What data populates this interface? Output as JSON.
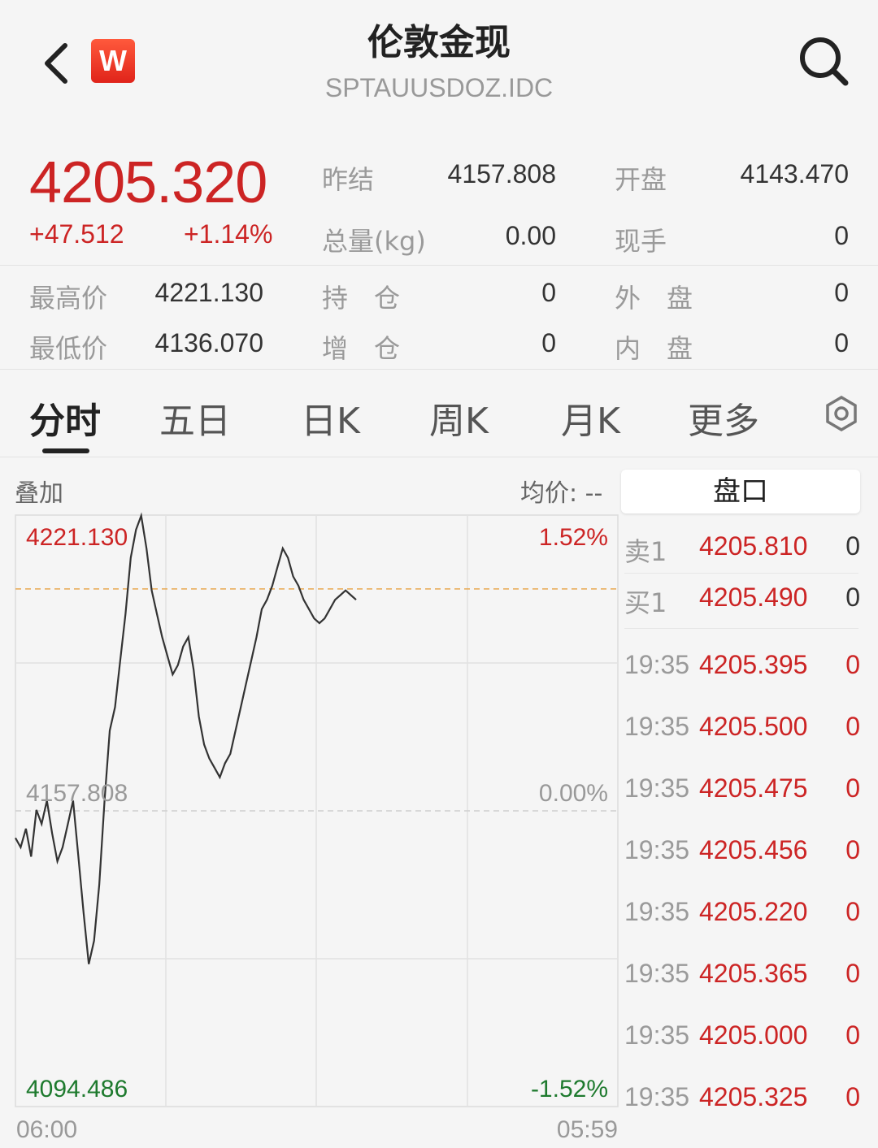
{
  "header": {
    "title": "伦敦金现",
    "subtitle": "SPTAUUSDOZ.IDC",
    "logo_letter": "W"
  },
  "quote": {
    "price": "4205.320",
    "change": "+47.512",
    "change_pct": "+1.14%",
    "stats": [
      {
        "label": "昨结",
        "value": "4157.808"
      },
      {
        "label": "开盘",
        "value": "4143.470"
      },
      {
        "label": "总量(kg)",
        "value": "0.00"
      },
      {
        "label": "现手",
        "value": "0"
      },
      {
        "label": "最高价",
        "value": "4221.130"
      },
      {
        "label": "持　仓",
        "value": "0"
      },
      {
        "label": "外　盘",
        "value": "0"
      },
      {
        "label": "最低价",
        "value": "4136.070"
      },
      {
        "label": "增　仓",
        "value": "0"
      },
      {
        "label": "内　盘",
        "value": "0"
      }
    ]
  },
  "tabs": [
    "分时",
    "五日",
    "日K",
    "周K",
    "月K",
    "更多"
  ],
  "active_tab": "分时",
  "chart_toolbar": {
    "overlay": "叠加",
    "avg_price": "均价: --"
  },
  "chart_data": {
    "type": "line",
    "price_high": 4221.13,
    "price_ref": 4157.808,
    "price_low": 4094.486,
    "high_label": "4221.130",
    "ref_label": "4157.808",
    "low_label": "4094.486",
    "pct_high": "1.52%",
    "pct_ref": "0.00%",
    "pct_low": "-1.52%",
    "x_start": "06:00",
    "x_end": "05:59",
    "current_price": 4205.32,
    "series": [
      {
        "values": [
          4152,
          4150,
          4154,
          4148,
          4158,
          4155,
          4160,
          4153,
          4147,
          4150,
          4155,
          4160,
          4148,
          4136,
          4125,
          4130,
          4142,
          4160,
          4175,
          4180,
          4190,
          4200,
          4212,
          4218,
          4221,
          4214,
          4205,
          4200,
          4195,
          4191,
          4187,
          4189,
          4193,
          4195,
          4188,
          4178,
          4172,
          4169,
          4167,
          4165,
          4168,
          4170,
          4175,
          4180,
          4185,
          4190,
          4195,
          4201,
          4203,
          4206,
          4210,
          4214,
          4212,
          4208,
          4206,
          4203,
          4201,
          4199,
          4198,
          4199,
          4201,
          4203,
          4204,
          4205,
          4204,
          4203
        ]
      }
    ]
  },
  "order_book": {
    "title": "盘口",
    "levels": [
      {
        "side": "卖1",
        "price": "4205.810",
        "qty": "0"
      },
      {
        "side": "买1",
        "price": "4205.490",
        "qty": "0"
      }
    ],
    "ticks": [
      {
        "time": "19:35",
        "price": "4205.395",
        "qty": "0"
      },
      {
        "time": "19:35",
        "price": "4205.500",
        "qty": "0"
      },
      {
        "time": "19:35",
        "price": "4205.475",
        "qty": "0"
      },
      {
        "time": "19:35",
        "price": "4205.456",
        "qty": "0"
      },
      {
        "time": "19:35",
        "price": "4205.220",
        "qty": "0"
      },
      {
        "time": "19:35",
        "price": "4205.365",
        "qty": "0"
      },
      {
        "time": "19:35",
        "price": "4205.000",
        "qty": "0"
      },
      {
        "time": "19:35",
        "price": "4205.325",
        "qty": "0"
      }
    ]
  },
  "colors": {
    "up": "#cc2424",
    "down": "#1e7a2e",
    "line": "#333333",
    "ref_line": "#e8a850"
  }
}
